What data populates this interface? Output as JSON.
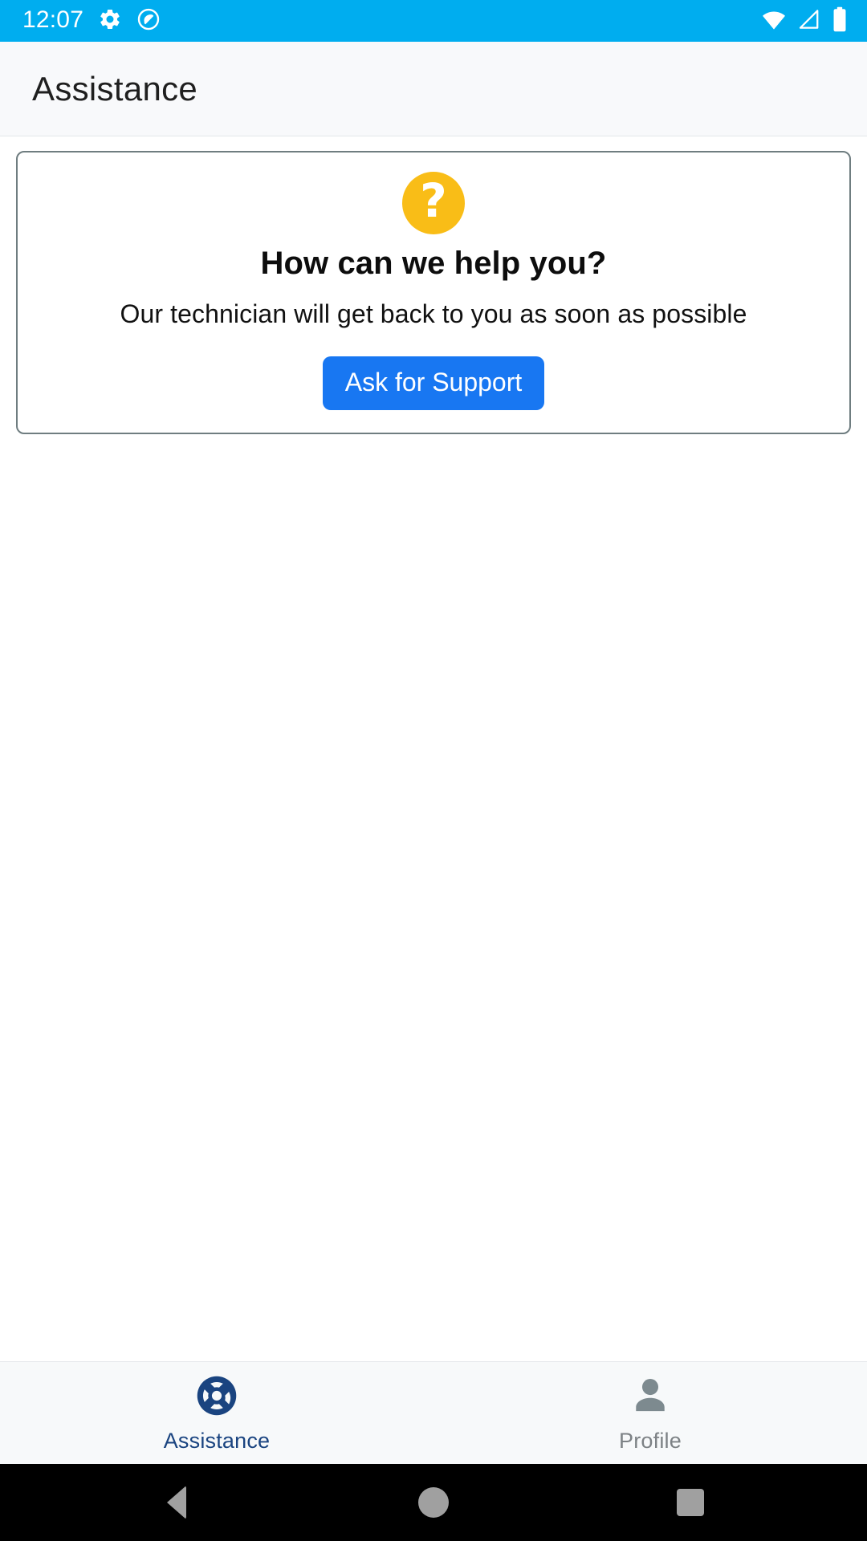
{
  "status_bar": {
    "time": "12:07",
    "left_icons": [
      "gear-icon",
      "do-not-disturb-icon"
    ],
    "right_icons": [
      "wifi-icon",
      "cellular-signal-icon",
      "battery-icon"
    ],
    "background_color": "#00ADEF"
  },
  "app_bar": {
    "title": "Assistance",
    "background_color": "#f8f9fb"
  },
  "help_card": {
    "icon": "question-mark-circle-icon",
    "icon_glyph": "?",
    "icon_color": "#f9bd17",
    "title": "How can we help you?",
    "subtitle": "Our technician will get back to you as soon as possible",
    "button_label": "Ask for Support",
    "button_color": "#1877f2",
    "border_color": "#6f7d80"
  },
  "bottom_nav": {
    "items": [
      {
        "label": "Assistance",
        "icon": "lifebuoy-icon",
        "active": true,
        "color": "#1a4480"
      },
      {
        "label": "Profile",
        "icon": "person-icon",
        "active": false,
        "color": "#7d8285"
      }
    ]
  },
  "system_nav": {
    "buttons": [
      {
        "name": "back-button",
        "icon": "triangle-back-icon"
      },
      {
        "name": "home-button",
        "icon": "circle-home-icon"
      },
      {
        "name": "recents-button",
        "icon": "square-recents-icon"
      }
    ],
    "icon_color": "#a0a0a0",
    "background_color": "#000000"
  }
}
